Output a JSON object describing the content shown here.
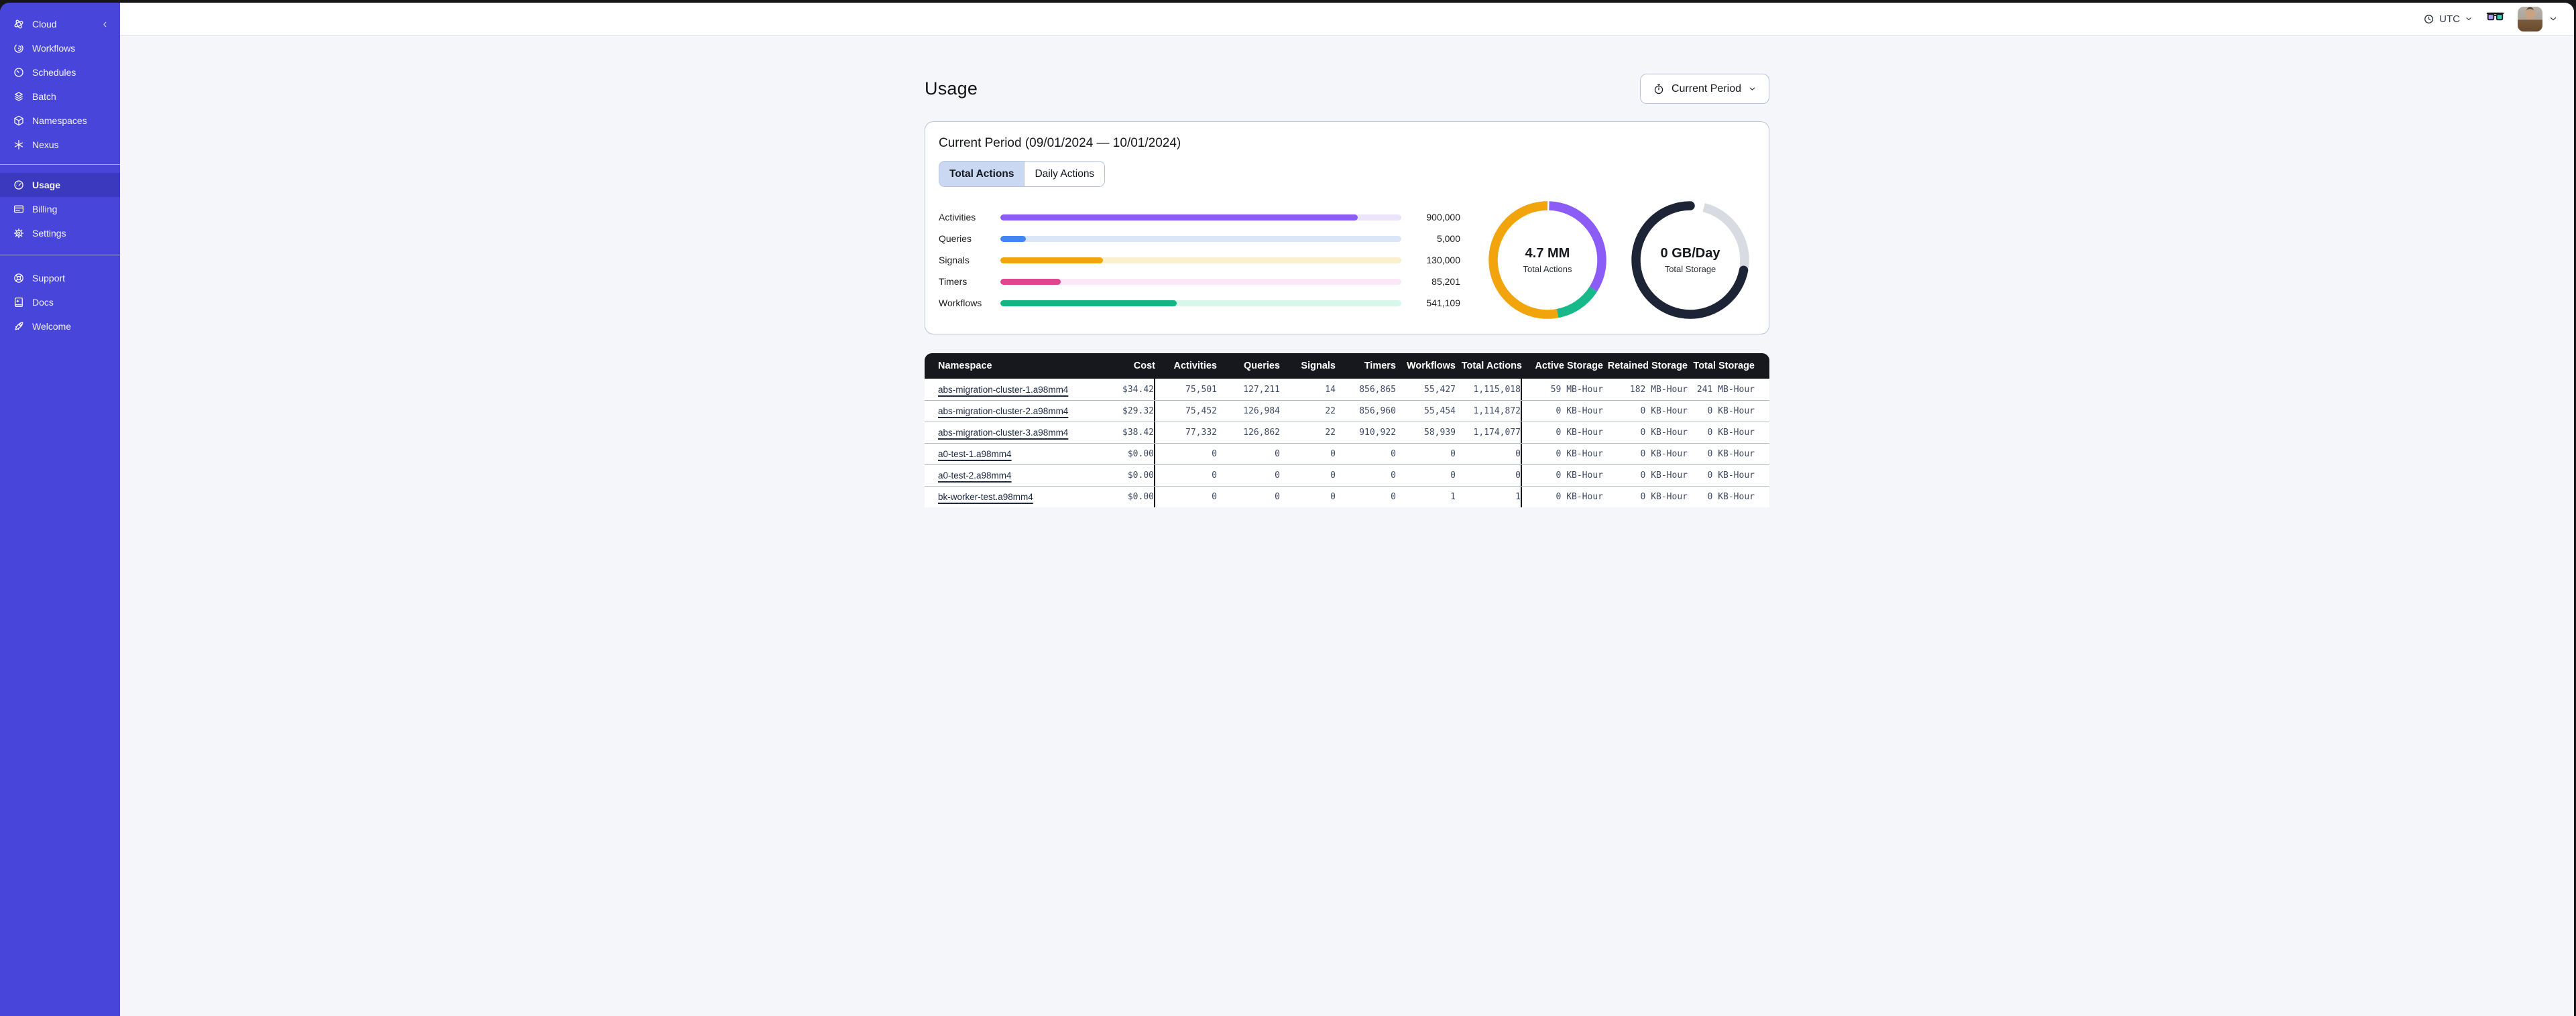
{
  "theme": {
    "sidebar_color": "#4845DB",
    "sidebar_active_color": "#3B39BE",
    "page_background": "#F4F6FA",
    "table_header_color": "#17181D",
    "card_border_color": "#B9C5DB",
    "active_tab_color": "#CBD8F1"
  },
  "sidebar": {
    "sections": [
      {
        "items": [
          {
            "icon": "temporal-cloud-icon",
            "label": "Cloud",
            "has_collapse": true
          },
          {
            "icon": "workflows-icon",
            "label": "Workflows"
          },
          {
            "icon": "schedules-icon",
            "label": "Schedules"
          },
          {
            "icon": "batch-icon",
            "label": "Batch"
          },
          {
            "icon": "namespaces-icon",
            "label": "Namespaces"
          },
          {
            "icon": "nexus-icon",
            "label": "Nexus"
          }
        ]
      },
      {
        "items": [
          {
            "icon": "usage-icon",
            "label": "Usage",
            "active": true
          },
          {
            "icon": "billing-icon",
            "label": "Billing"
          },
          {
            "icon": "settings-icon",
            "label": "Settings"
          }
        ]
      },
      {
        "items": [
          {
            "icon": "support-icon",
            "label": "Support"
          },
          {
            "icon": "docs-icon",
            "label": "Docs"
          },
          {
            "icon": "welcome-icon",
            "label": "Welcome"
          }
        ]
      }
    ]
  },
  "topbar": {
    "timezone": "UTC",
    "icons": [
      "clock-icon",
      "chevron-down-icon",
      "glasses-icon",
      "avatar",
      "chevron-down-icon"
    ]
  },
  "page": {
    "title": "Usage",
    "period_selector_label": "Current Period"
  },
  "usage_card": {
    "title": "Current Period (09/01/2024 — 10/01/2024)",
    "tabs": [
      "Total Actions",
      "Daily Actions"
    ],
    "active_tab": "Total Actions"
  },
  "chart_data": [
    {
      "type": "bar",
      "orientation": "horizontal",
      "rows": [
        {
          "label": "Activities",
          "value": 900000,
          "display_value": "900,000",
          "fraction": 0.892,
          "color": "#8B5CF6",
          "track_color": "#EBE4FB"
        },
        {
          "label": "Queries",
          "value": 5000,
          "display_value": "5,000",
          "fraction": 0.064,
          "color": "#4285F4",
          "track_color": "#DAE7F9"
        },
        {
          "label": "Signals",
          "value": 130000,
          "display_value": "130,000",
          "fraction": 0.256,
          "color": "#F2A40D",
          "track_color": "#FBF0CD"
        },
        {
          "label": "Timers",
          "value": 85201,
          "display_value": "85,201",
          "fraction": 0.15,
          "color": "#E0458F",
          "track_color": "#FBE7F8"
        },
        {
          "label": "Workflows",
          "value": 541109,
          "display_value": "541,109",
          "fraction": 0.439,
          "color": "#12B583",
          "track_color": "#D9F6EA"
        }
      ]
    },
    {
      "type": "donut",
      "center_value": "4.7 MM",
      "center_label": "Total Actions",
      "segments": [
        {
          "name": "activities",
          "color": "#8B5CF6",
          "from": 0.005,
          "to": 0.34
        },
        {
          "name": "workflows",
          "color": "#17B98B",
          "from": 0.34,
          "to": 0.47
        },
        {
          "name": "signals",
          "color": "#F2A40D",
          "from": 0.47,
          "to": 1.005
        }
      ]
    },
    {
      "type": "donut",
      "center_value": "0 GB/Day",
      "center_label": "Total Storage",
      "segments": [
        {
          "name": "remaining",
          "color": "#D8DBE1",
          "from": 0.04,
          "to": 0.28
        },
        {
          "name": "used",
          "color": "#1C2435",
          "from": 0.28,
          "to": 1.04,
          "cap": "round"
        }
      ]
    }
  ],
  "table": {
    "columns": [
      "Namespace",
      "Cost",
      "Activities",
      "Queries",
      "Signals",
      "Timers",
      "Workflows",
      "Total Actions",
      "Active Storage",
      "Retained Storage",
      "Total Storage"
    ],
    "rows": [
      {
        "namespace": "abs-migration-cluster-1.a98mm4",
        "cost": "$34.42",
        "activities": "75,501",
        "queries": "127,211",
        "signals": "14",
        "timers": "856,865",
        "workflows": "55,427",
        "total_actions": "1,115,018",
        "active_storage": "59 MB-Hour",
        "retained_storage": "182 MB-Hour",
        "total_storage": "241 MB-Hour"
      },
      {
        "namespace": "abs-migration-cluster-2.a98mm4",
        "cost": "$29.32",
        "activities": "75,452",
        "queries": "126,984",
        "signals": "22",
        "timers": "856,960",
        "workflows": "55,454",
        "total_actions": "1,114,872",
        "active_storage": "0 KB-Hour",
        "retained_storage": "0 KB-Hour",
        "total_storage": "0 KB-Hour"
      },
      {
        "namespace": "abs-migration-cluster-3.a98mm4",
        "cost": "$38.42",
        "activities": "77,332",
        "queries": "126,862",
        "signals": "22",
        "timers": "910,922",
        "workflows": "58,939",
        "total_actions": "1,174,077",
        "active_storage": "0 KB-Hour",
        "retained_storage": "0 KB-Hour",
        "total_storage": "0 KB-Hour"
      },
      {
        "namespace": "a0-test-1.a98mm4",
        "cost": "$0.00",
        "activities": "0",
        "queries": "0",
        "signals": "0",
        "timers": "0",
        "workflows": "0",
        "total_actions": "0",
        "active_storage": "0 KB-Hour",
        "retained_storage": "0 KB-Hour",
        "total_storage": "0 KB-Hour"
      },
      {
        "namespace": "a0-test-2.a98mm4",
        "cost": "$0.00",
        "activities": "0",
        "queries": "0",
        "signals": "0",
        "timers": "0",
        "workflows": "0",
        "total_actions": "0",
        "active_storage": "0 KB-Hour",
        "retained_storage": "0 KB-Hour",
        "total_storage": "0 KB-Hour"
      },
      {
        "namespace": "bk-worker-test.a98mm4",
        "cost": "$0.00",
        "activities": "0",
        "queries": "0",
        "signals": "0",
        "timers": "0",
        "workflows": "1",
        "total_actions": "1",
        "active_storage": "0 KB-Hour",
        "retained_storage": "0 KB-Hour",
        "total_storage": "0 KB-Hour"
      }
    ]
  }
}
